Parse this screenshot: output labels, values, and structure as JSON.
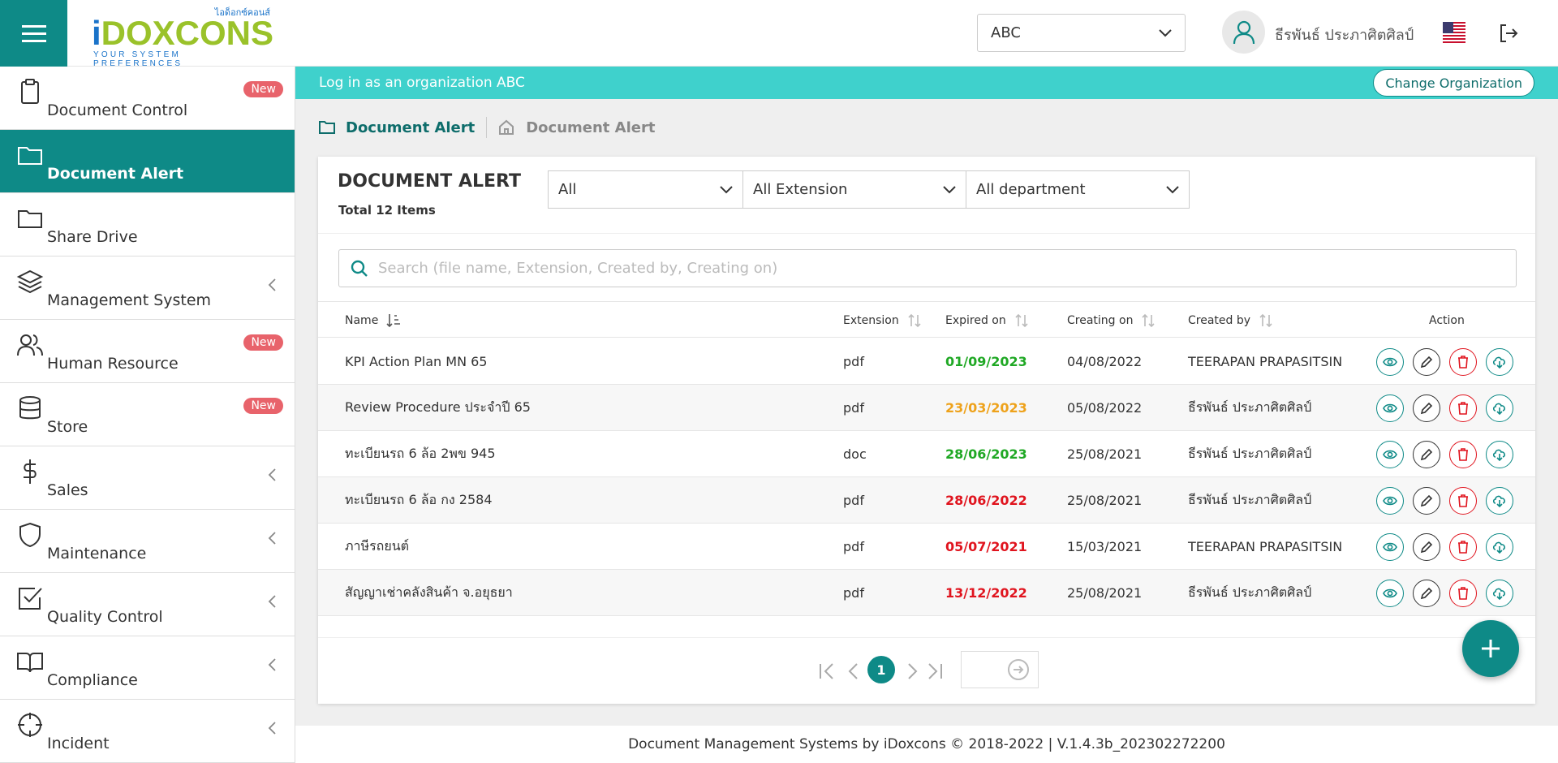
{
  "header": {
    "logo_thai": "ไอด็อกซ์คอนส์",
    "logo_i": "i",
    "logo_rest": "DOXCONS",
    "logo_sub": "YOUR SYSTEM  PREFERENCES",
    "org_value": "ABC",
    "user_name": "ธีรพันธ์ ประภาศิตศิลป์"
  },
  "sidebar": {
    "items": [
      {
        "label": "Document Control",
        "icon": "clipboard-icon",
        "badge": "New"
      },
      {
        "label": "Document Alert",
        "icon": "folder-icon",
        "active": true
      },
      {
        "label": "Share Drive",
        "icon": "folder-icon"
      },
      {
        "label": "Management System",
        "icon": "layers-icon"
      },
      {
        "label": "Human Resource",
        "icon": "users-icon",
        "badge": "New"
      },
      {
        "label": "Store",
        "icon": "database-icon",
        "badge": "New"
      },
      {
        "label": "Sales",
        "icon": "dollar-icon"
      },
      {
        "label": "Maintenance",
        "icon": "shield-icon"
      },
      {
        "label": "Quality Control",
        "icon": "check-square-icon"
      },
      {
        "label": "Compliance",
        "icon": "book-icon"
      },
      {
        "label": "Incident",
        "icon": "crosshair-icon"
      }
    ]
  },
  "banner": {
    "text": "Log in as an organization ABC",
    "change_org": "Change Organization"
  },
  "breadcrumb": {
    "current": "Document Alert",
    "home": "Document Alert"
  },
  "card": {
    "title": "DOCUMENT ALERT",
    "total": "Total 12 Items",
    "filters": [
      "All",
      "All Extension",
      "All department"
    ],
    "search_placeholder": "Search (file name, Extension, Created by, Creating on)"
  },
  "table": {
    "headers": [
      "Name",
      "Extension",
      "Expired on",
      "Creating on",
      "Created by",
      "Action"
    ],
    "rows": [
      {
        "name": "KPI Action Plan MN 65",
        "ext": "pdf",
        "expired": "01/09/2023",
        "expired_status": "ok",
        "created_on": "04/08/2022",
        "created_by": "TEERAPAN PRAPASITSIN"
      },
      {
        "name": "Review Procedure ประจำปี 65",
        "ext": "pdf",
        "expired": "23/03/2023",
        "expired_status": "warning",
        "created_on": "05/08/2022",
        "created_by": "ธีรพันธ์ ประภาศิตศิลป์"
      },
      {
        "name": "ทะเบียนรถ 6 ล้อ 2พข 945",
        "ext": "doc",
        "expired": "28/06/2023",
        "expired_status": "ok",
        "created_on": "25/08/2021",
        "created_by": "ธีรพันธ์ ประภาศิตศิลป์"
      },
      {
        "name": "ทะเบียนรถ 6 ล้อ กง 2584",
        "ext": "pdf",
        "expired": "28/06/2022",
        "expired_status": "expired",
        "created_on": "25/08/2021",
        "created_by": "ธีรพันธ์ ประภาศิตศิลป์"
      },
      {
        "name": "ภาษีรถยนต์",
        "ext": "pdf",
        "expired": "05/07/2021",
        "expired_status": "expired",
        "created_on": "15/03/2021",
        "created_by": "TEERAPAN PRAPASITSIN"
      },
      {
        "name": "สัญญาเช่าคลังสินค้า จ.อยุธยา",
        "ext": "pdf",
        "expired": "13/12/2022",
        "expired_status": "expired",
        "created_on": "25/08/2021",
        "created_by": "ธีรพันธ์ ประภาศิตศิลป์"
      }
    ]
  },
  "pagination": {
    "current": "1"
  },
  "footer": "Document Management Systems by iDoxcons © 2018-2022  |  V.1.4.3b_202302272200",
  "colors": {
    "brand": "#0e8a87",
    "banner": "#3fd1cc",
    "ok": "#1fa824",
    "warning": "#eea21b",
    "expired": "#e0141e",
    "badge": "#e8636b"
  }
}
